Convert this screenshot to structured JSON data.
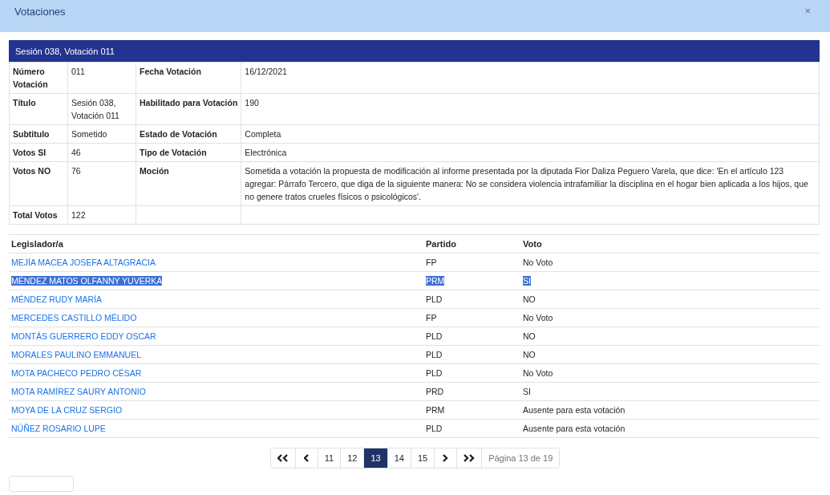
{
  "dialog": {
    "title": "Votaciones",
    "close": "×"
  },
  "card": {
    "title": "Sesión 038, Votación 011",
    "details": [
      {
        "label1": "Número Votación",
        "value1": "011",
        "label2": "Fecha Votación",
        "value2": "16/12/2021"
      },
      {
        "label1": "Título",
        "value1": "Sesión 038, Votación 011",
        "label2": "Habilitado para Votación",
        "value2": "190"
      },
      {
        "label1": "Subtitulo",
        "value1": "Sometido",
        "label2": "Estado de Votación",
        "value2": "Completa"
      },
      {
        "label1": "Votos SI",
        "value1": "46",
        "label2": "Tipo de Votación",
        "value2": "Electrónica"
      },
      {
        "label1": "Votos NO",
        "value1": "76",
        "label2": "Moción",
        "value2": "Sometida a votación la propuesta de modificación al informe presentada por la diputada Fior Daliza Peguero Varela, que dice: 'En el artículo 123 agregar: Párrafo Tercero, que diga de la siguiente manera: No se considera violencia intrafamiliar la disciplina en el hogar bien aplicada a los hijos, que no genere tratos crueles físicos o psicológicos'."
      },
      {
        "label1": "Total Votos",
        "value1": "122"
      }
    ]
  },
  "votes": {
    "columns": [
      "Legislador/a",
      "Partido",
      "Voto"
    ],
    "rows": [
      {
        "name": "MEJÍA MACEA JOSEFA ALTAGRACIA",
        "party": "FP",
        "vote": "No Voto",
        "selected": false
      },
      {
        "name": "MÉNDEZ MATOS OLFANNY YUVERKA",
        "party": "PRM",
        "vote": "SI",
        "selected": true
      },
      {
        "name": "MÉNDEZ RUDY MARÍA",
        "party": "PLD",
        "vote": "NO",
        "selected": false
      },
      {
        "name": "MERCEDES CASTILLO MÉLIDO",
        "party": "FP",
        "vote": "No Voto",
        "selected": false
      },
      {
        "name": "MONTÁS GUERRERO EDDY OSCAR",
        "party": "PLD",
        "vote": "NO",
        "selected": false
      },
      {
        "name": "MORALES PAULINO EMMANUEL",
        "party": "PLD",
        "vote": "NO",
        "selected": false
      },
      {
        "name": "MOTA PACHECO PEDRO CÉSAR",
        "party": "PLD",
        "vote": "No Voto",
        "selected": false
      },
      {
        "name": "MOTA RAMÍREZ SAURY ANTONIO",
        "party": "PRD",
        "vote": "SI",
        "selected": false
      },
      {
        "name": "MOYA DE LA CRUZ SERGIO",
        "party": "PRM",
        "vote": "Ausente para esta votación",
        "selected": false
      },
      {
        "name": "NÚÑEZ ROSARIO LUPE",
        "party": "PLD",
        "vote": "Ausente para esta votación",
        "selected": false
      }
    ]
  },
  "pagination": {
    "items": [
      {
        "kind": "first"
      },
      {
        "kind": "prev"
      },
      {
        "kind": "page",
        "label": "11",
        "selected": false
      },
      {
        "kind": "page",
        "label": "12",
        "selected": false
      },
      {
        "kind": "page",
        "label": "13",
        "selected": true
      },
      {
        "kind": "page",
        "label": "14",
        "selected": false
      },
      {
        "kind": "page",
        "label": "15",
        "selected": false
      },
      {
        "kind": "next"
      },
      {
        "kind": "last"
      }
    ],
    "info": "Página 13 de 19"
  }
}
